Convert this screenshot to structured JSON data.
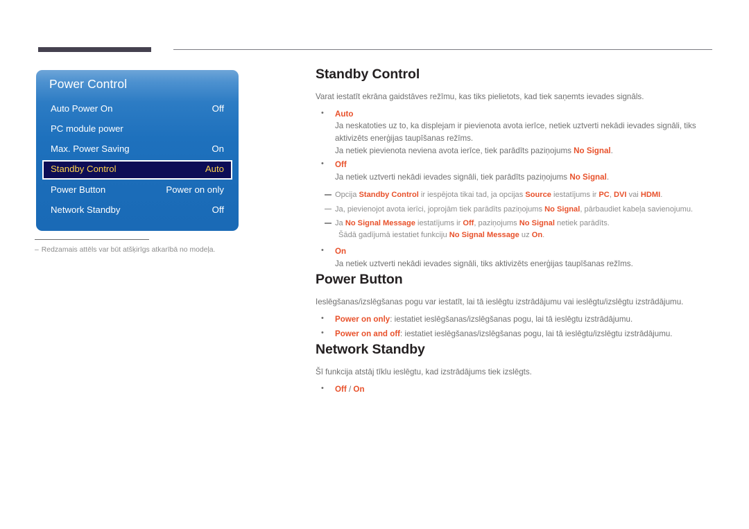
{
  "osd": {
    "title": "Power Control",
    "rows": [
      {
        "label": "Auto Power On",
        "value": "Off",
        "selected": false
      },
      {
        "label": "PC module power",
        "value": "",
        "selected": false
      },
      {
        "label": "Max. Power Saving",
        "value": "On",
        "selected": false
      },
      {
        "label": "Standby Control",
        "value": "Auto",
        "selected": true
      },
      {
        "label": "Power Button",
        "value": "Power on only",
        "selected": false
      },
      {
        "label": "Network Standby",
        "value": "Off",
        "selected": false
      }
    ],
    "colors": {
      "panel_top": "#6ea5d8",
      "panel_bottom": "#1a6ab6",
      "selected_bg": "#0d0d56",
      "selected_text": "#ffd34d",
      "row_text": "#ffffff"
    }
  },
  "caption": {
    "dash": "–",
    "text": "Redzamais attēls var būt atšķirīgs atkarībā no modeļa."
  },
  "sections": {
    "standby_control": {
      "title": "Standby Control",
      "intro": "Varat iestatīt ekrāna gaidstāves režīmu, kas tiks pielietots, kad tiek saņemts ievades signāls.",
      "auto": {
        "option": "Auto",
        "line1": "Ja neskatoties uz to, ka displejam ir pievienota avota ierīce, netiek uztverti nekādi ievades signāli, tiks aktivizēts enerģijas taupīšanas režīms.",
        "line2_a": "Ja netiek pievienota neviena avota ierīce, tiek parādīts paziņojums ",
        "line2_hl": "No Signal",
        "line2_b": "."
      },
      "off": {
        "option": "Off",
        "line1_a": "Ja netiek uztverti nekādi ievades signāli, tiek parādīts paziņojums ",
        "line1_hl": "No Signal",
        "line1_b": "."
      },
      "notes": [
        {
          "parts": [
            {
              "t": "Opcija ",
              "hl": false
            },
            {
              "t": "Standby Control",
              "hl": true
            },
            {
              "t": " ir iespējota tikai tad, ja opcijas ",
              "hl": false
            },
            {
              "t": "Source",
              "hl": true
            },
            {
              "t": " iestatījums ir ",
              "hl": false
            },
            {
              "t": "PC",
              "hl": true
            },
            {
              "t": ", ",
              "hl": false
            },
            {
              "t": "DVI",
              "hl": true
            },
            {
              "t": " vai ",
              "hl": false
            },
            {
              "t": "HDMI",
              "hl": true
            },
            {
              "t": ".",
              "hl": false
            }
          ]
        },
        {
          "parts": [
            {
              "t": "Ja, pievienojot avota ierīci, joprojām tiek parādīts paziņojums ",
              "hl": false
            },
            {
              "t": "No Signal",
              "hl": true
            },
            {
              "t": ", pārbaudiet kabeļa savienojumu.",
              "hl": false
            }
          ]
        },
        {
          "parts": [
            {
              "t": "Ja ",
              "hl": false
            },
            {
              "t": "No Signal Message",
              "hl": true
            },
            {
              "t": " iestatījums ir ",
              "hl": false
            },
            {
              "t": "Off",
              "hl": true
            },
            {
              "t": ", paziņojums ",
              "hl": false
            },
            {
              "t": "No Signal",
              "hl": true
            },
            {
              "t": " netiek parādīts.",
              "hl": false
            }
          ],
          "cont_parts": [
            {
              "t": "Šādā gadījumā iestatiet funkciju ",
              "hl": false
            },
            {
              "t": "No Signal Message",
              "hl": true
            },
            {
              "t": " uz ",
              "hl": false
            },
            {
              "t": "On",
              "hl": true
            },
            {
              "t": ".",
              "hl": false
            }
          ]
        }
      ],
      "on": {
        "option": "On",
        "line1": "Ja netiek uztverti nekādi ievades signāli, tiks aktivizēts enerģijas taupīšanas režīms."
      }
    },
    "power_button": {
      "title": "Power Button",
      "intro": "Ieslēgšanas/izslēgšanas pogu var iestatīt, lai tā ieslēgtu izstrādājumu vai ieslēgtu/izslēgtu izstrādājumu.",
      "items": [
        {
          "option": "Power on only",
          "rest": ": iestatiet ieslēgšanas/izslēgšanas pogu, lai tā ieslēgtu izstrādājumu."
        },
        {
          "option": "Power on and off",
          "rest": ": iestatiet ieslēgšanas/izslēgšanas pogu, lai tā ieslēgtu/izslēgtu izstrādājumu."
        }
      ]
    },
    "network_standby": {
      "title": "Network Standby",
      "intro": "Šī funkcija atstāj tīklu ieslēgtu, kad izstrādājums tiek izslēgts.",
      "option_off": "Off",
      "option_sep": " / ",
      "option_on": "On"
    }
  }
}
